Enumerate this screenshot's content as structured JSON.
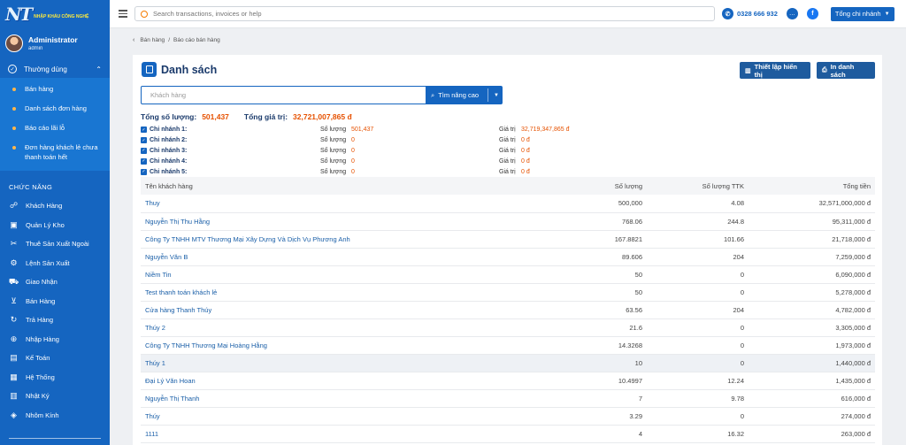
{
  "logo": {
    "mark": "NT",
    "tagline": "NHẬP KHẨU CÔNG NGHỆ"
  },
  "user": {
    "name": "Administrator",
    "role": "admin"
  },
  "sidebar": {
    "group": {
      "label": "Thường dùng",
      "items": [
        "Bán hàng",
        "Danh sách đơn hàng",
        "Báo cáo lãi lỗ",
        "Đơn hàng khách lẻ chưa thanh toán hết"
      ]
    },
    "section_title": "CHỨC NĂNG",
    "menu": [
      {
        "label": "Khách Hàng",
        "icon": "customers-icon",
        "glyph": "☍"
      },
      {
        "label": "Quản Lý Kho",
        "icon": "warehouse-icon",
        "glyph": "▣"
      },
      {
        "label": "Thuê Sản Xuất Ngoài",
        "icon": "tools-icon",
        "glyph": "✂"
      },
      {
        "label": "Lệnh Sản Xuất",
        "icon": "production-icon",
        "glyph": "⚙"
      },
      {
        "label": "Giao Nhận",
        "icon": "truck-icon",
        "glyph": "⛟"
      },
      {
        "label": "Bán Hàng",
        "icon": "cart-icon",
        "glyph": "⊻"
      },
      {
        "label": "Trả Hàng",
        "icon": "return-icon",
        "glyph": "↻"
      },
      {
        "label": "Nhập Hàng",
        "icon": "import-icon",
        "glyph": "⊕"
      },
      {
        "label": "Kế Toán",
        "icon": "accounting-icon",
        "glyph": "▤"
      },
      {
        "label": "Hệ Thống",
        "icon": "system-icon",
        "glyph": "▦"
      },
      {
        "label": "Nhật Ký",
        "icon": "log-icon",
        "glyph": "▥"
      },
      {
        "label": "Nhôm Kính",
        "icon": "glass-icon",
        "glyph": "◈"
      }
    ]
  },
  "topbar": {
    "search_placeholder": "Search transactions, invoices or help",
    "phone": "0328 666 932",
    "branch_button": "Tổng chi nhánh"
  },
  "breadcrumb": [
    "Bán hàng",
    "Báo cáo bán hàng"
  ],
  "card": {
    "title": "Danh sách",
    "layout_button": "Thiết lập hiển thị",
    "print_button": "In danh sách",
    "customer_placeholder": "Khách hàng",
    "advanced_search": "Tìm nâng cao",
    "total_qty_label": "Tổng số lượng:",
    "total_qty": "501,437",
    "total_value_label": "Tổng giá trị:",
    "total_value": "32,721,007,865 đ",
    "qty_label": "Số lượng",
    "value_label": "Giá trị",
    "branches": [
      {
        "name": "Chi nhánh 1:",
        "qty": "501,437",
        "value": "32,719,347,865 đ"
      },
      {
        "name": "Chi nhánh 2:",
        "qty": "0",
        "value": "0 đ"
      },
      {
        "name": "Chi nhánh 3:",
        "qty": "0",
        "value": "0 đ"
      },
      {
        "name": "Chi nhánh 4:",
        "qty": "0",
        "value": "0 đ"
      },
      {
        "name": "Chi nhánh 5:",
        "qty": "0",
        "value": "0 đ"
      }
    ]
  },
  "table": {
    "columns": [
      "Tên khách hàng",
      "Số lượng",
      "Số lượng TTK",
      "Tổng tiền"
    ],
    "rows": [
      [
        "Thuy",
        "500,000",
        "4.08",
        "32,571,000,000 đ"
      ],
      [
        "Nguyễn Thị Thu Hằng",
        "768.06",
        "244.8",
        "95,311,000 đ"
      ],
      [
        "Công Ty TNHH MTV Thương Mại Xây Dựng Và Dịch Vụ Phương Anh",
        "167.8821",
        "101.66",
        "21,718,000 đ"
      ],
      [
        "Nguyễn Văn B",
        "89.606",
        "204",
        "7,259,000 đ"
      ],
      [
        "Niềm Tin",
        "50",
        "0",
        "6,090,000 đ"
      ],
      [
        "Test thanh toán khách lẻ",
        "50",
        "0",
        "5,278,000 đ"
      ],
      [
        "Cửa hàng Thanh Thúy",
        "63.56",
        "204",
        "4,782,000 đ"
      ],
      [
        "Thúy 2",
        "21.6",
        "0",
        "3,305,000 đ"
      ],
      [
        "Công Ty TNHH Thương Mại Hoàng Hằng",
        "14.3268",
        "0",
        "1,973,000 đ"
      ],
      [
        "Thúy 1",
        "10",
        "0",
        "1,440,000 đ"
      ],
      [
        "Đại Lý Văn Hoan",
        "10.4997",
        "12.24",
        "1,435,000 đ"
      ],
      [
        "Nguyễn Thị Thanh",
        "7",
        "9.78",
        "616,000 đ"
      ],
      [
        "Thúy",
        "3.29",
        "0",
        "274,000 đ"
      ],
      [
        "1111",
        "4",
        "16.32",
        "263,000 đ"
      ]
    ],
    "highlighted_row": 9
  }
}
